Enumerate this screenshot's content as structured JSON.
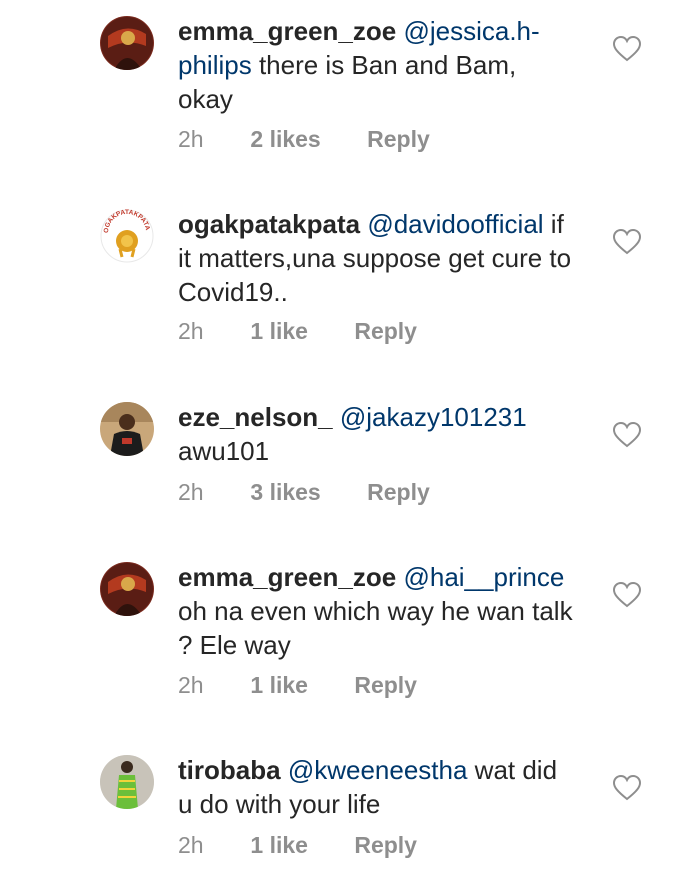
{
  "comments": [
    {
      "username": "emma_green_zoe",
      "mention": "@jessica.h-philips",
      "text": " there is Ban and Bam, okay",
      "time": "2h",
      "likes": "2 likes",
      "reply": "Reply",
      "avatar": "profile-photo-dark"
    },
    {
      "username": "ogakpatakpata",
      "mention": "@davidoofficial",
      "text": " if it matters,una suppose get cure to Covid19..",
      "time": "2h",
      "likes": "1 like",
      "reply": "Reply",
      "avatar": "lion-logo",
      "avatar_logo_text": "OGAKPATAKPATA"
    },
    {
      "username": "eze_nelson_",
      "mention": "@jakazy101231",
      "text": " awu101",
      "time": "2h",
      "likes": "3 likes",
      "reply": "Reply",
      "avatar": "profile-photo-man"
    },
    {
      "username": "emma_green_zoe",
      "mention": "@hai__prince",
      "text": " oh na even which way he wan talk ? Ele way",
      "time": "2h",
      "likes": "1 like",
      "reply": "Reply",
      "avatar": "profile-photo-dark"
    },
    {
      "username": "tirobaba",
      "mention": "@kweeneestha",
      "text": " wat did u do with your life",
      "time": "2h",
      "likes": "1 like",
      "reply": "Reply",
      "avatar": "profile-photo-green"
    }
  ],
  "colors": {
    "text": "#262626",
    "mention": "#00376b",
    "meta": "#8e8e8e",
    "heart_stroke": "#8e8e8e"
  }
}
